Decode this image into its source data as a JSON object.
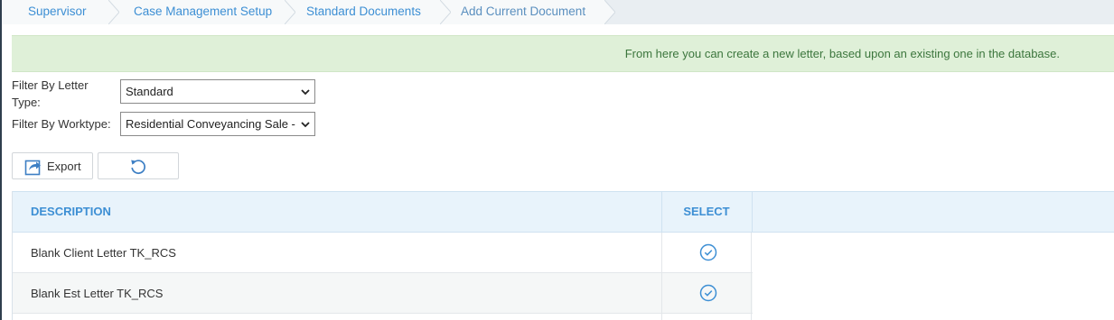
{
  "breadcrumb": {
    "items": [
      {
        "label": "Supervisor"
      },
      {
        "label": "Case Management Setup"
      },
      {
        "label": "Standard Documents"
      },
      {
        "label": "Add Current Document"
      }
    ]
  },
  "banner": {
    "message": "From here you can create a new letter, based upon an existing one in the database."
  },
  "filters": {
    "letter_type_label": "Filter By Letter Type:",
    "letter_type_value": "Standard",
    "worktype_label": "Filter By Worktype:",
    "worktype_value": "Residential Conveyancing Sale - TK"
  },
  "toolbar": {
    "export_label": "Export",
    "export_icon": "export-icon",
    "refresh_icon": "refresh-icon"
  },
  "table": {
    "columns": [
      "DESCRIPTION",
      "SELECT"
    ],
    "rows": [
      {
        "description": "Blank Client Letter TK_RCS",
        "select_icon": "check-circle-icon"
      },
      {
        "description": "Blank Est Letter TK_RCS",
        "select_icon": "check-circle-icon"
      }
    ]
  },
  "colors": {
    "accent": "#3d8fd4",
    "banner_bg": "#dff0d8",
    "banner_text": "#3c763d",
    "header_bg": "#e8f3fb"
  }
}
